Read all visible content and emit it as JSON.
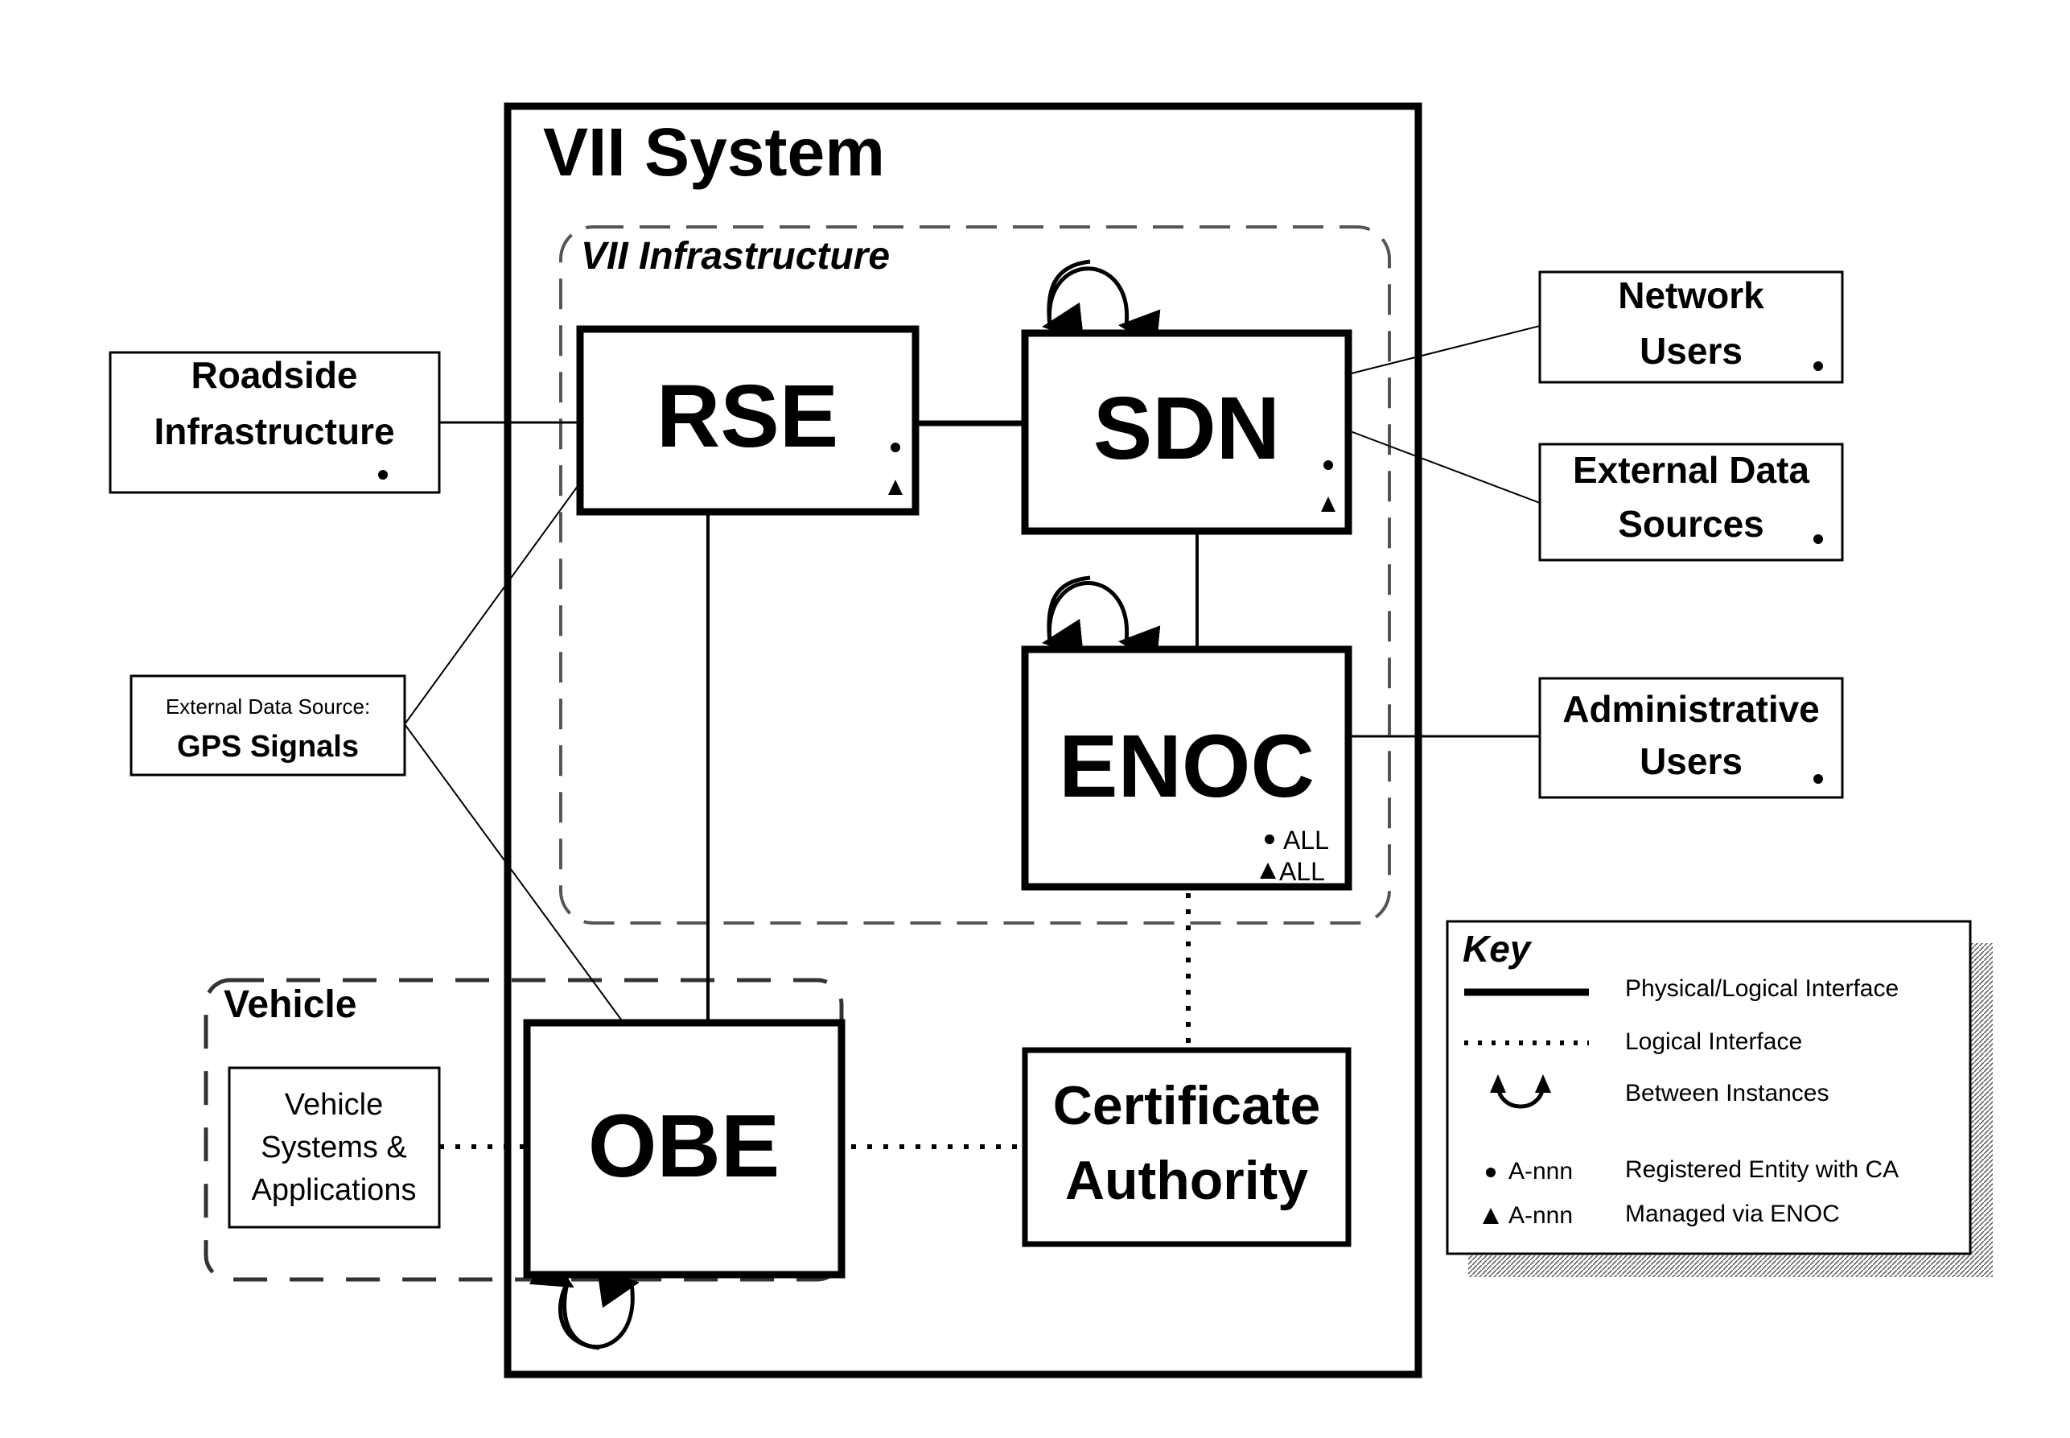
{
  "title": "VII System",
  "infrastructure_label": "VII Infrastructure",
  "vehicle_label": "Vehicle",
  "core_nodes": {
    "rse": {
      "label": "RSE",
      "markers": [
        "circle",
        "triangle"
      ]
    },
    "sdn": {
      "label": "SDN",
      "markers": [
        "circle",
        "triangle"
      ]
    },
    "enoc": {
      "label": "ENOC",
      "marker_circle_text": "ALL",
      "marker_triangle_text": "ALL"
    },
    "obe": {
      "label": "OBE"
    },
    "ca": {
      "line1": "Certificate",
      "line2": "Authority"
    }
  },
  "external_nodes": {
    "roadside": {
      "line1": "Roadside",
      "line2": "Infrastructure",
      "marker": "circle"
    },
    "gps": {
      "line1": "External Data Source:",
      "line2": "GPS Signals"
    },
    "network_users": {
      "line1": "Network",
      "line2": "Users",
      "marker": "circle"
    },
    "external_data": {
      "line1": "External Data",
      "line2": "Sources",
      "marker": "circle"
    },
    "admin_users": {
      "line1": "Administrative",
      "line2": "Users",
      "marker": "circle"
    },
    "vehicle_systems": {
      "line1": "Vehicle",
      "line2": "Systems &",
      "line3": "Applications"
    }
  },
  "connections": [
    {
      "from": "Roadside Infrastructure",
      "to": "RSE",
      "type": "physical/logical"
    },
    {
      "from": "RSE",
      "to": "SDN",
      "type": "physical/logical"
    },
    {
      "from": "RSE",
      "to": "OBE",
      "type": "physical/logical"
    },
    {
      "from": "SDN",
      "to": "ENOC",
      "type": "physical/logical"
    },
    {
      "from": "SDN",
      "to": "Network Users",
      "type": "physical/logical"
    },
    {
      "from": "SDN",
      "to": "External Data Sources",
      "type": "physical/logical"
    },
    {
      "from": "ENOC",
      "to": "Administrative Users",
      "type": "physical/logical"
    },
    {
      "from": "GPS Signals",
      "to": "RSE",
      "type": "physical/logical"
    },
    {
      "from": "GPS Signals",
      "to": "OBE",
      "type": "physical/logical"
    },
    {
      "from": "ENOC",
      "to": "Certificate Authority",
      "type": "logical"
    },
    {
      "from": "OBE",
      "to": "Certificate Authority",
      "type": "logical"
    },
    {
      "from": "Vehicle Systems & Applications",
      "to": "OBE",
      "type": "logical"
    },
    {
      "from": "SDN",
      "to": "SDN",
      "type": "between instances"
    },
    {
      "from": "ENOC",
      "to": "ENOC",
      "type": "between instances"
    },
    {
      "from": "OBE",
      "to": "OBE",
      "type": "between instances"
    }
  ],
  "key": {
    "title": "Key",
    "items": [
      {
        "symbol": "",
        "label": "Physical/Logical Interface"
      },
      {
        "symbol": "",
        "label": "Logical Interface"
      },
      {
        "symbol": "",
        "label": "Between Instances"
      },
      {
        "symbol": "A-nnn",
        "label": "Registered Entity with CA"
      },
      {
        "symbol": "A-nnn",
        "label": "Managed via ENOC"
      }
    ]
  }
}
